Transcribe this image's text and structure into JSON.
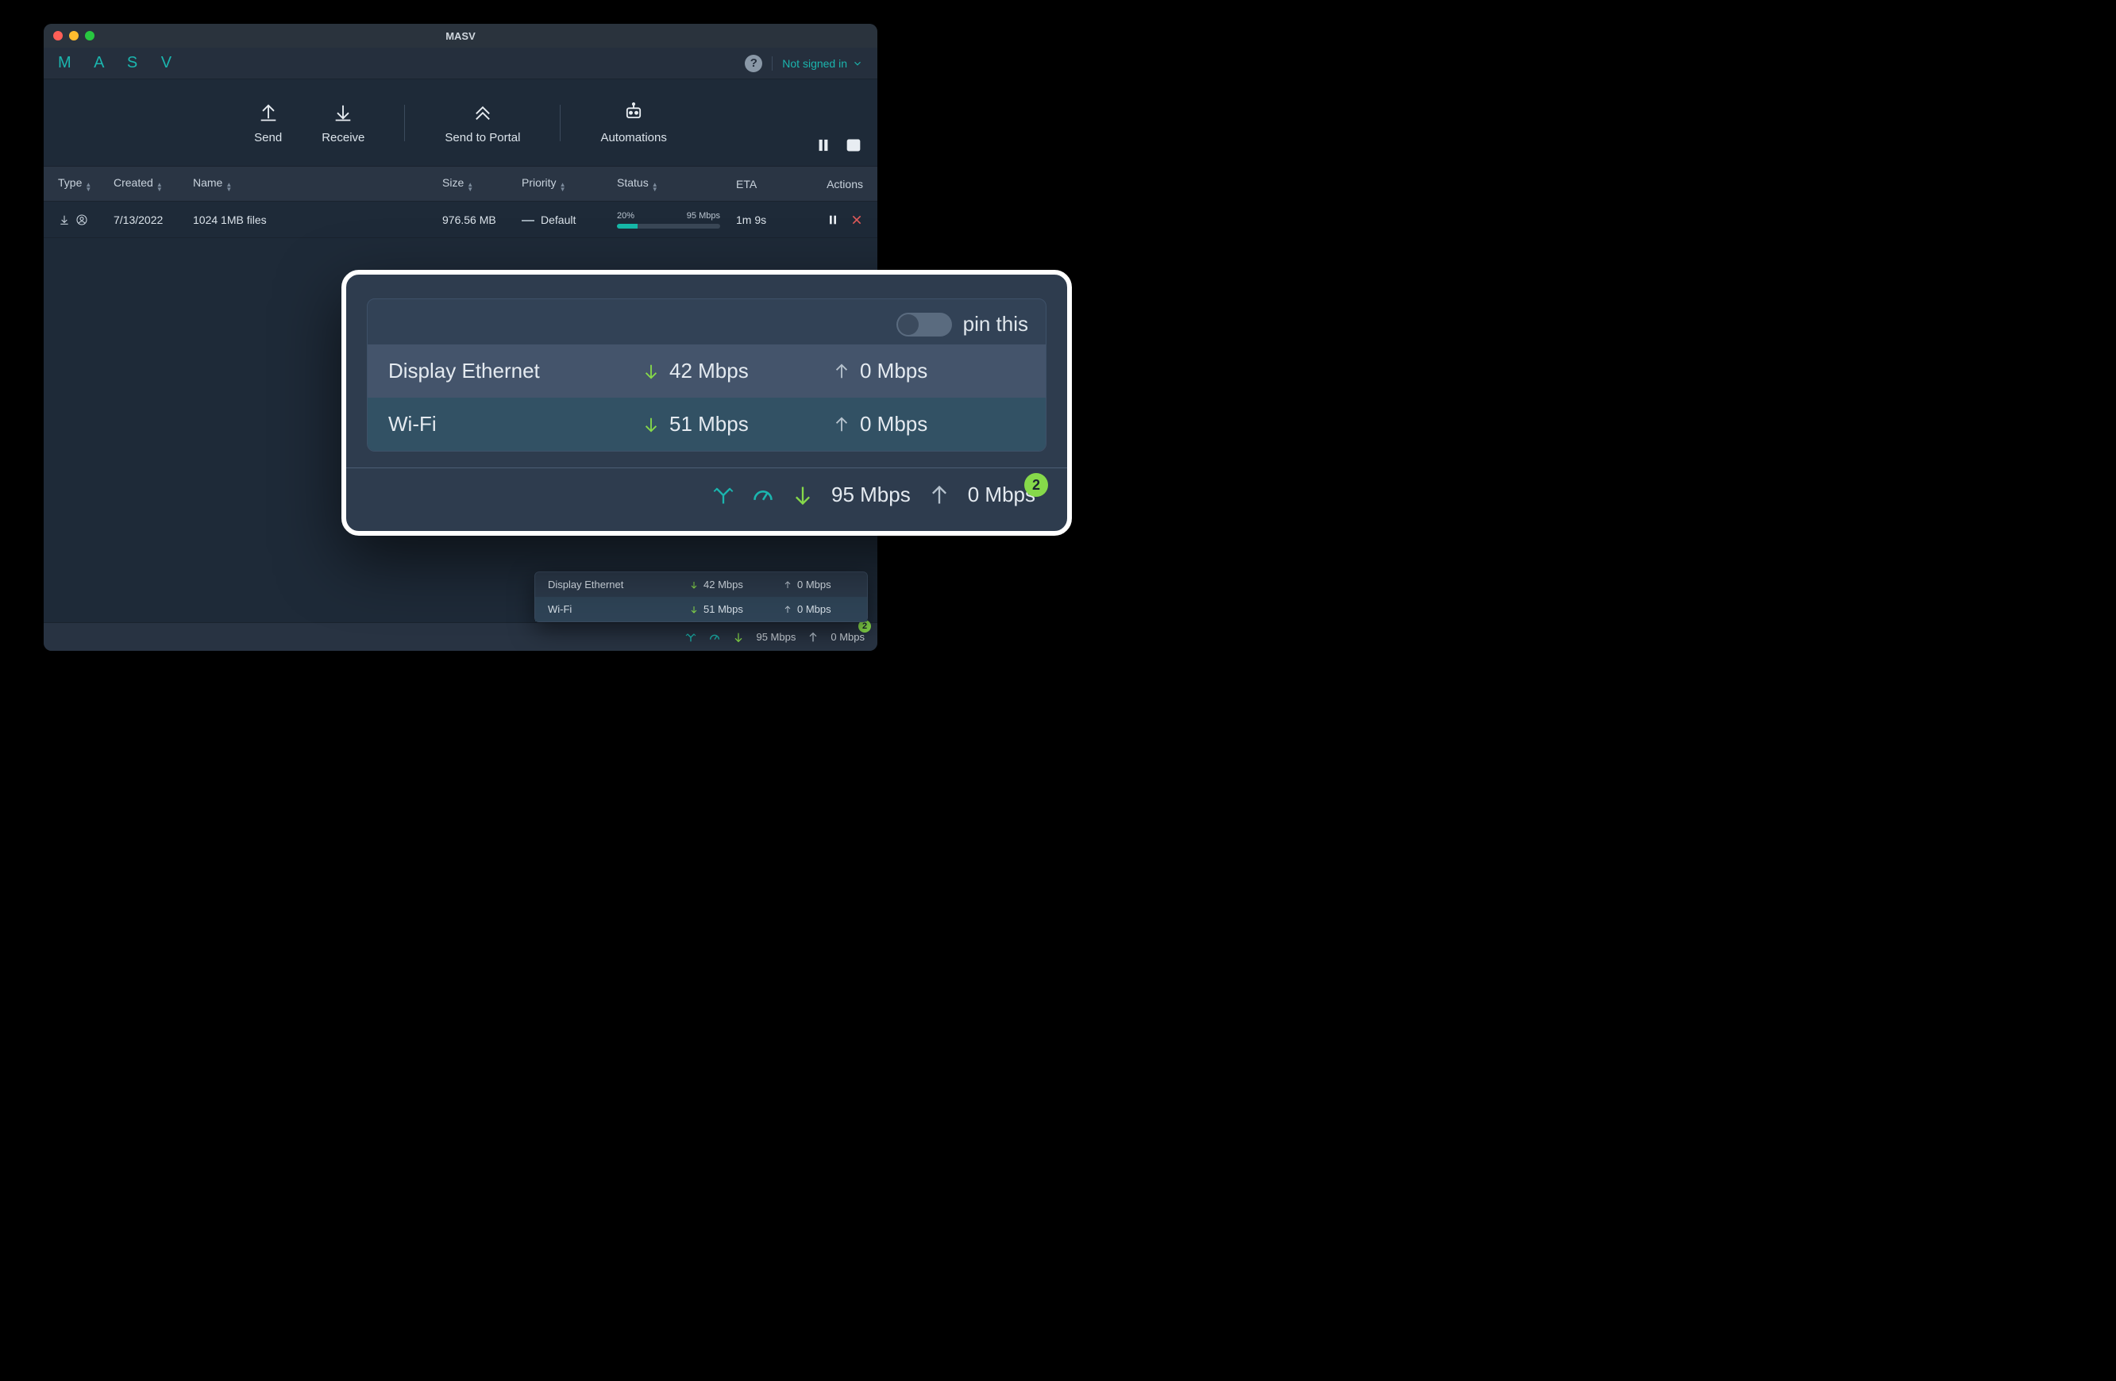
{
  "window": {
    "title": "MASV"
  },
  "brand": {
    "logo_text": "M A S V"
  },
  "header": {
    "signin_label": "Not signed in"
  },
  "toolbar": {
    "send": "Send",
    "receive": "Receive",
    "portal": "Send to Portal",
    "automations": "Automations"
  },
  "columns": {
    "type": "Type",
    "created": "Created",
    "name": "Name",
    "size": "Size",
    "priority": "Priority",
    "status": "Status",
    "eta": "ETA",
    "actions": "Actions"
  },
  "rows": [
    {
      "created": "7/13/2022",
      "name": "1024 1MB files",
      "size": "976.56 MB",
      "priority_label": "Default",
      "progress_pct_label": "20%",
      "progress_pct": 20,
      "speed_label": "95 Mbps",
      "eta": "1m 9s"
    }
  ],
  "statusbar": {
    "down": "95 Mbps",
    "up": "0 Mbps",
    "badge": "2"
  },
  "mini_popover": {
    "rows": [
      {
        "name": "Display Ethernet",
        "down": "42 Mbps",
        "up": "0 Mbps"
      },
      {
        "name": "Wi-Fi",
        "down": "51 Mbps",
        "up": "0 Mbps"
      }
    ]
  },
  "big_popover": {
    "pin_label": "pin this",
    "interfaces": [
      {
        "name": "Display Ethernet",
        "down": "42 Mbps",
        "up": "0 Mbps"
      },
      {
        "name": "Wi-Fi",
        "down": "51 Mbps",
        "up": "0 Mbps"
      }
    ],
    "summary": {
      "down": "95 Mbps",
      "up": "0 Mbps",
      "badge": "2"
    }
  },
  "colors": {
    "accent_teal": "#1bb5ae",
    "progress_green": "#16b8a8",
    "badge_green": "#86d94a",
    "close_red": "#e05a5a"
  }
}
